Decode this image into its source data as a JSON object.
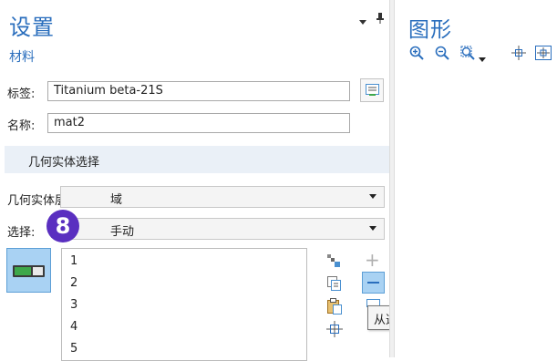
{
  "settings": {
    "title": "设置",
    "subtitle": "材料",
    "pin_glyph": "▾ ▮"
  },
  "form": {
    "label_label": "标签:",
    "label_value": "Titanium beta-21S",
    "name_label": "名称:",
    "name_value": "mat2"
  },
  "section": {
    "title": "几何实体选择"
  },
  "geometry_level": {
    "label": "几何实体层:",
    "value": "域"
  },
  "selection": {
    "label": "选择:",
    "value": "手动",
    "badge": "8",
    "badge_color": "#5a2fc0"
  },
  "list": {
    "items": [
      "1",
      "2",
      "3",
      "4",
      "5"
    ]
  },
  "tooltip": {
    "text": "从选择中移除"
  },
  "graphics": {
    "title": "图形",
    "tools": [
      "zoom-in-icon",
      "zoom-out-icon",
      "zoom-box-icon",
      "dropdown-icon",
      "center-icon",
      "zoom-extents-icon"
    ]
  },
  "colors": {
    "accent": "#2a6ebd",
    "toggle_on": "#3ea84a",
    "active_button": "#a9d2f3"
  }
}
